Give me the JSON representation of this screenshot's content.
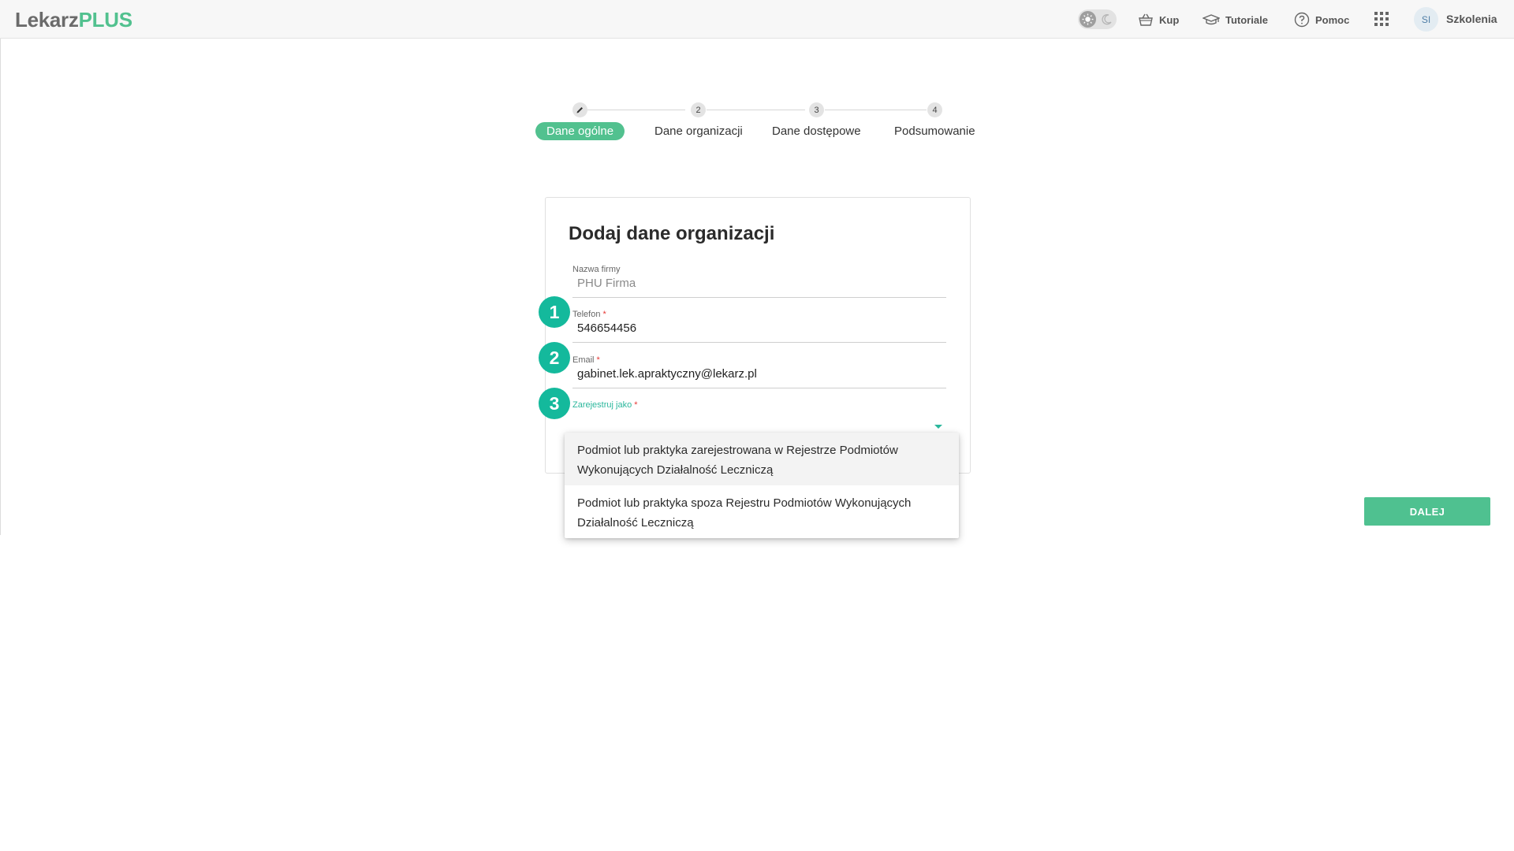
{
  "app": {
    "logo_part1": "Lekarz",
    "logo_part2": "PLUS"
  },
  "header": {
    "buy": "Kup",
    "tutorials": "Tutoriale",
    "help": "Pomoc",
    "avatar_initials": "SI",
    "user": "Szkolenia"
  },
  "stepper": {
    "steps": [
      {
        "number": "",
        "label": "Dane ogólne",
        "icon": "pencil-icon",
        "active": true
      },
      {
        "number": "2",
        "label": "Dane organizacji"
      },
      {
        "number": "3",
        "label": "Dane dostępowe"
      },
      {
        "number": "4",
        "label": "Podsumowanie"
      }
    ]
  },
  "form": {
    "title": "Dodaj dane organizacji",
    "company_label": "Nazwa firmy",
    "company_value": "PHU Firma",
    "phone_label": "Telefon",
    "phone_value": "546654456",
    "email_label": "Email",
    "email_value": "gabinet.lek.apraktyczny@lekarz.pl",
    "register_label": "Zarejestruj jako",
    "required_mark": "*"
  },
  "dropdown": {
    "options": [
      "Podmiot lub praktyka zarejestrowana w Rejestrze Podmiotów Wykonujących Działalność Leczniczą",
      "Podmiot lub praktyka spoza Rejestru Podmiotów Wykonujących Działalność Leczniczą"
    ]
  },
  "annotations": [
    "1",
    "2",
    "3"
  ],
  "buttons": {
    "next": "DALEJ"
  },
  "colors": {
    "brand": "#52c18f",
    "badge": "#14b99c",
    "required": "#e53935"
  }
}
